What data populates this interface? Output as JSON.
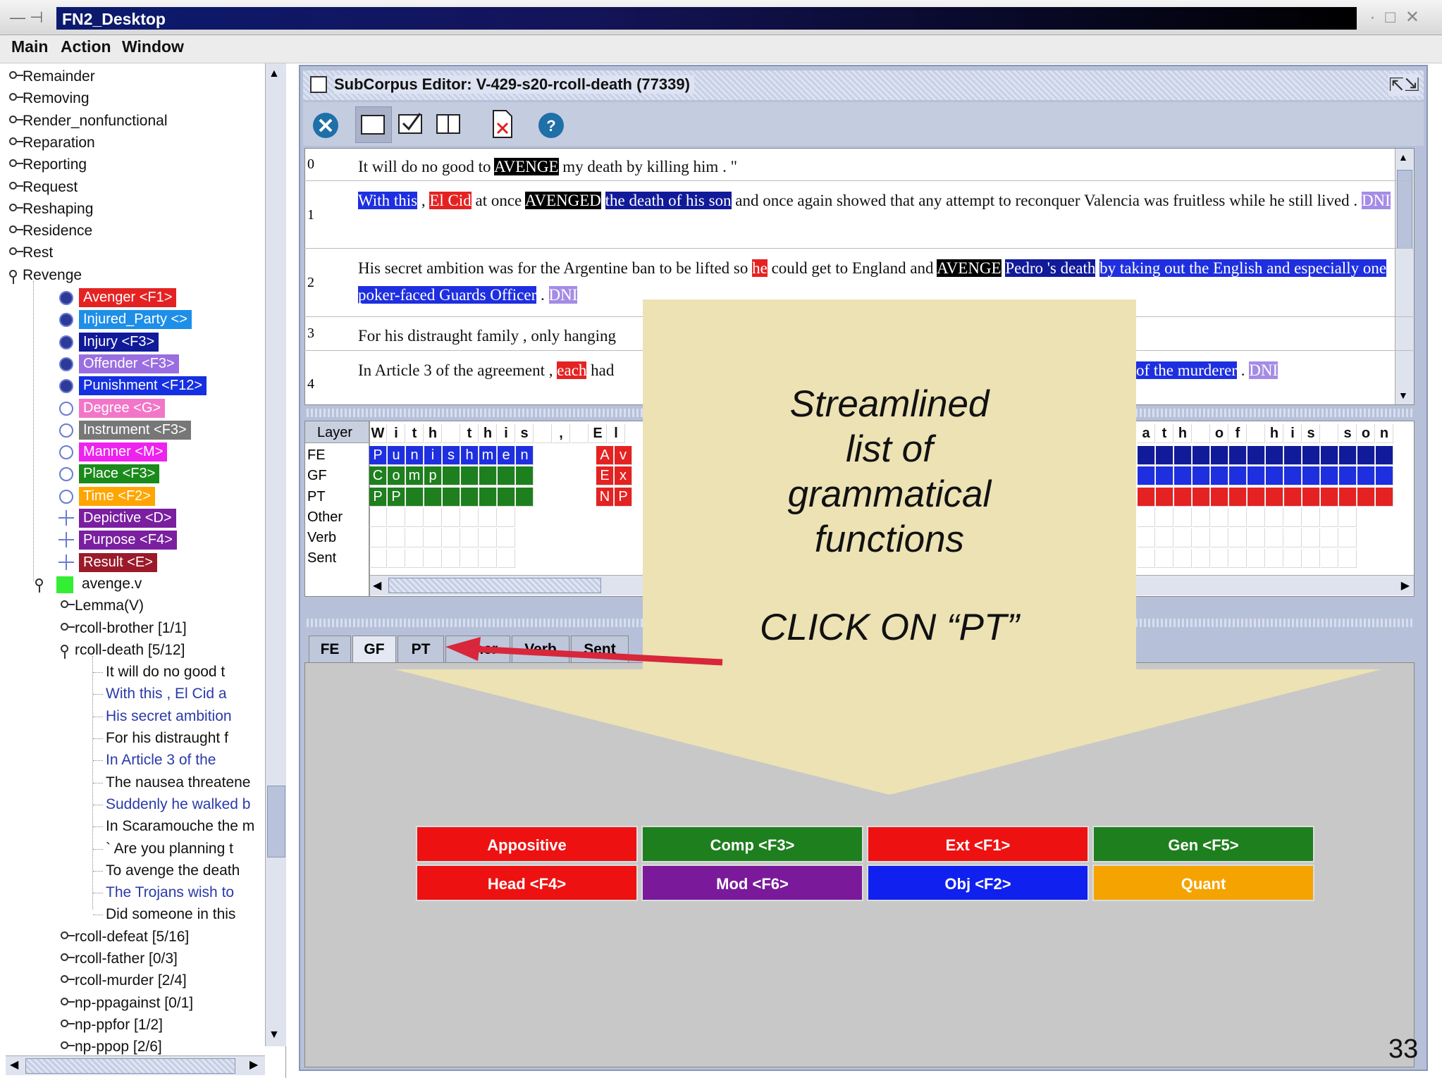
{
  "window": {
    "title": "FN2_Desktop"
  },
  "menu": [
    "Main",
    "Action",
    "Window"
  ],
  "tree": {
    "frames": [
      "Remainder",
      "Removing",
      "Render_nonfunctional",
      "Reparation",
      "Reporting",
      "Request",
      "Reshaping",
      "Residence",
      "Rest",
      "Revenge"
    ],
    "frame_elements": [
      {
        "label": "Avenger <F1>",
        "color": "#e52222",
        "kind": "core"
      },
      {
        "label": "Injured_Party <>",
        "color": "#1e8fe8",
        "kind": "core"
      },
      {
        "label": "Injury <F3>",
        "color": "#111a99",
        "kind": "core"
      },
      {
        "label": "Offender <F3>",
        "color": "#9a6ee0",
        "kind": "core"
      },
      {
        "label": "Punishment <F12>",
        "color": "#1530e0",
        "kind": "core"
      },
      {
        "label": "Degree <G>",
        "color": "#f276c8",
        "kind": "peripheral"
      },
      {
        "label": "Instrument <F3>",
        "color": "#777777",
        "kind": "peripheral"
      },
      {
        "label": "Manner <M>",
        "color": "#ee22ee",
        "kind": "peripheral"
      },
      {
        "label": "Place <F3>",
        "color": "#1a8a1a",
        "kind": "peripheral"
      },
      {
        "label": "Time <F2>",
        "color": "#ffa500",
        "kind": "peripheral"
      },
      {
        "label": "Depictive <D>",
        "color": "#7a1fa0",
        "kind": "extra"
      },
      {
        "label": "Purpose <F4>",
        "color": "#7a1fa0",
        "kind": "extra"
      },
      {
        "label": "Result <E>",
        "color": "#9a1a2a",
        "kind": "extra"
      }
    ],
    "lu": "avenge.v",
    "lu_children_top": [
      "Lemma(V)",
      "rcoll-brother [1/1]",
      "rcoll-death [5/12]"
    ],
    "sentences": [
      {
        "text": "It will do no good t",
        "color": "#111111"
      },
      {
        "text": "With this , El Cid a",
        "color": "#2a3aa8"
      },
      {
        "text": "His secret ambition",
        "color": "#2a3aa8"
      },
      {
        "text": "For his distraught f",
        "color": "#111111"
      },
      {
        "text": "In Article 3 of the",
        "color": "#2a3aa8"
      },
      {
        "text": "The nausea threatene",
        "color": "#111111"
      },
      {
        "text": "Suddenly he walked b",
        "color": "#2a3aa8"
      },
      {
        "text": "In Scaramouche the m",
        "color": "#111111"
      },
      {
        "text": "` Are you planning t",
        "color": "#111111"
      },
      {
        "text": "To avenge the death",
        "color": "#111111"
      },
      {
        "text": "The Trojans wish to",
        "color": "#2a3aa8"
      },
      {
        "text": "Did someone in this",
        "color": "#111111"
      }
    ],
    "lu_children_bottom": [
      "rcoll-defeat [5/16]",
      "rcoll-father [0/3]",
      "rcoll-murder [2/4]",
      "np-ppagainst [0/1]",
      "np-ppfor [1/2]",
      "np-ppop [2/6]"
    ]
  },
  "editor": {
    "title": "SubCorpus Editor: V-429-s20-rcoll-death (77339)",
    "sentence_numbers": [
      "0",
      "1",
      "2",
      "3",
      "4"
    ],
    "s0": {
      "a": "It will do no good to ",
      "target": "AVENGE",
      "b": " my death by killing him . \""
    },
    "s1": {
      "a": "With this",
      "b": " , ",
      "c": "El Cid",
      "d": " at once ",
      "target": "AVENGED",
      "e": " ",
      "f": "the death of his son",
      "g": " and once again showed that any attempt to reconquer Valencia was fruitless while he still lived . ",
      "dni": "DNI"
    },
    "s2": {
      "a": "His secret ambition was for the Argentine ban to be lifted so ",
      "b": "he",
      "c": " could get to England and ",
      "target": "AVENGE",
      "d": " ",
      "e": "Pedro 's death",
      "f": " ",
      "g": "by taking out the English and especially one poker-faced Guards Officer",
      "h": " . ",
      "dni": "DNI"
    },
    "s3": "For his distraught family , only hanging",
    "s4": {
      "a": "In Article 3 of the agreement , ",
      "b": "each",
      "c": " had",
      "d": "of the murderer",
      "e": " . ",
      "dni": "DNI"
    }
  },
  "layers": {
    "header": "Layer",
    "rows": [
      "FE",
      "GF",
      "PT",
      "Other",
      "Verb",
      "Sent"
    ],
    "word_left": "With this , El",
    "word_right": "ath of his son",
    "fe_cells": "Punishmen",
    "gf_cells": "Comp",
    "pt_cells": "PP",
    "fe_cells2": "Av",
    "gf_cells2": "Ext",
    "pt_cells2": "NP"
  },
  "tabs": [
    "FE",
    "GF",
    "PT",
    "Other",
    "Verb",
    "Sent"
  ],
  "gf_buttons": [
    {
      "label": "Appositive",
      "color": "#ee1111"
    },
    {
      "label": "Comp <F3>",
      "color": "#1e7f1e"
    },
    {
      "label": "Ext <F1>",
      "color": "#ee1111"
    },
    {
      "label": "Gen <F5>",
      "color": "#1e7f1e"
    },
    {
      "label": "Head <F4>",
      "color": "#ee1111"
    },
    {
      "label": "Mod <F6>",
      "color": "#7a1a9a"
    },
    {
      "label": "Obj <F2>",
      "color": "#1020ee"
    },
    {
      "label": "Quant",
      "color": "#f5a300"
    }
  ],
  "callout": {
    "line1": "Streamlined",
    "line2": "list of",
    "line3": "grammatical",
    "line4": "functions",
    "line5": "CLICK ON “PT”"
  },
  "page_number": "33"
}
